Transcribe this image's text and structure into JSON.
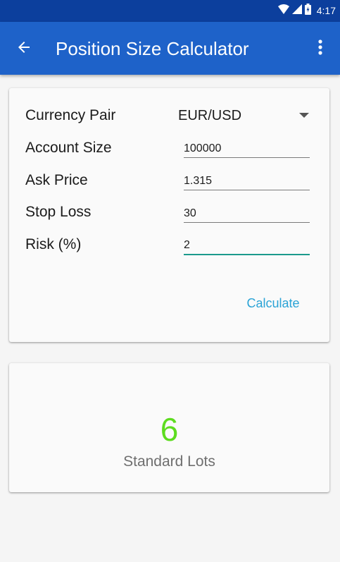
{
  "status_bar": {
    "time": "4:17",
    "icons": [
      "wifi-icon",
      "cell-signal-icon",
      "battery-icon"
    ]
  },
  "app_bar": {
    "title": "Position Size Calculator",
    "back_icon": "arrow-back-icon",
    "menu_icon": "more-vert-icon"
  },
  "form": {
    "currency_pair": {
      "label": "Currency Pair",
      "value": "EUR/USD"
    },
    "account_size": {
      "label": "Account Size",
      "value": "100000"
    },
    "ask_price": {
      "label": "Ask Price",
      "value": "1.315"
    },
    "stop_loss": {
      "label": "Stop Loss",
      "value": "30"
    },
    "risk": {
      "label": "Risk (%)",
      "value": "2"
    },
    "calculate_label": "Calculate"
  },
  "result": {
    "value": "6",
    "unit": "Standard Lots"
  },
  "colors": {
    "status_bar": "#0c3f9d",
    "app_bar": "#1e62c9",
    "accent": "#1c9a8c",
    "button_text": "#2aa3d6",
    "result_value": "#5ddc1f"
  }
}
